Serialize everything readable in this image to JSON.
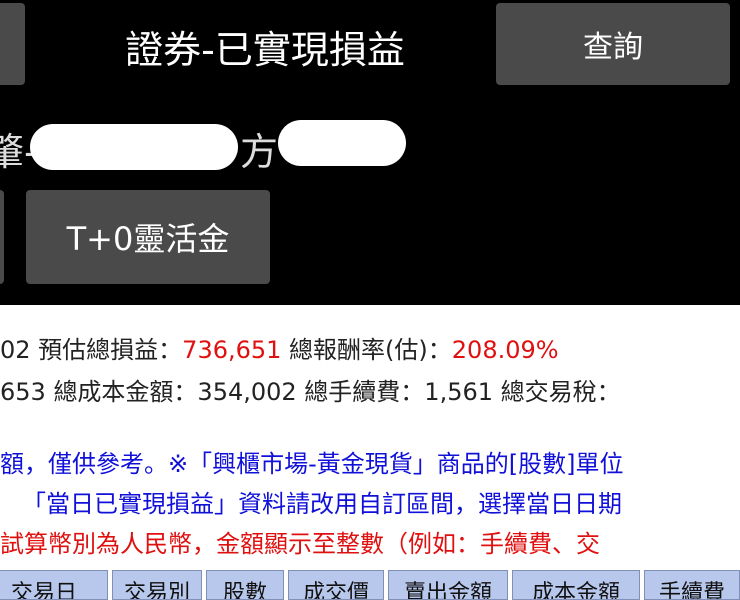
{
  "header": {
    "title": "證券-已實現損益",
    "query_label": "查詢"
  },
  "account": {
    "prefix": "肇-",
    "middle": "方"
  },
  "tabs": {
    "t0_label": "T+0靈活金"
  },
  "summary": {
    "line1_prefix": "02  預估總損益：",
    "total_pl": "736,651",
    "return_label": "  總報酬率(估)：",
    "return_rate": "208.09%",
    "line2": "653  總成本金額：354,002  總手續費：1,561  總交易稅："
  },
  "notes": {
    "line1": "額，僅供參考。※「興櫃市場-黃金現貨」商品的[股數]單位",
    "line2": "「當日已實現損益」資料請改用自訂區間，選擇當日日期",
    "line3": "試算幣別為人民幣，金額顯示至整數（例如：手續費、交"
  },
  "table": {
    "headers": [
      "交易日",
      "交易別",
      "股數",
      "成交價",
      "賣出金額",
      "成本金額",
      "手續費"
    ]
  },
  "colors": {
    "accent_red": "#e01010",
    "note_blue": "#1010d8",
    "button_gray": "#4a4a4a",
    "header_bg": "#b8c8ec"
  }
}
